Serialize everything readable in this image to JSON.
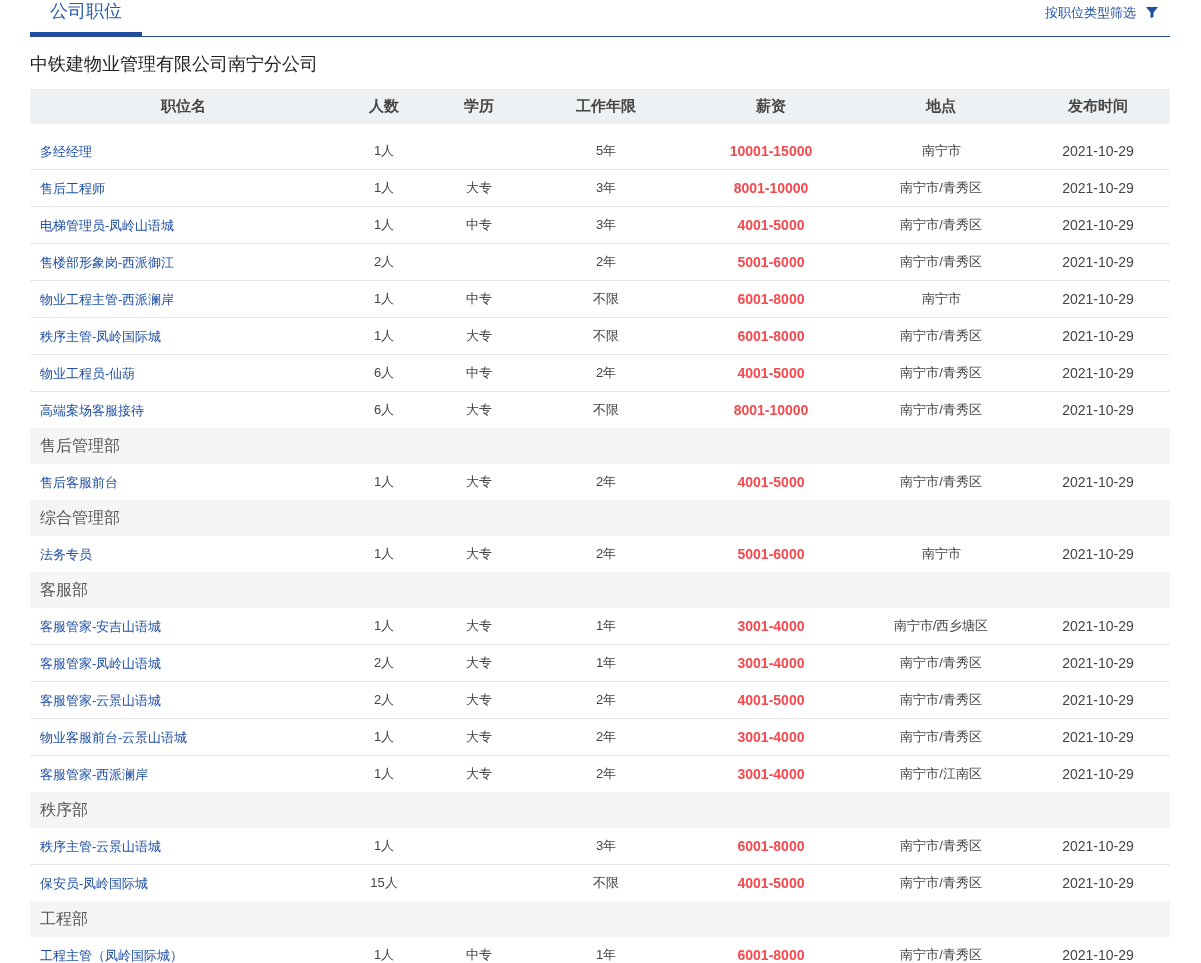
{
  "tabs": [
    {
      "label": "公司职位",
      "selected": true
    }
  ],
  "filter": {
    "label": "按职位类型筛选"
  },
  "company": "中铁建物业管理有限公司南宁分公司",
  "columns": [
    "职位名",
    "人数",
    "学历",
    "工作年限",
    "薪资",
    "地点",
    "发布时间"
  ],
  "groups": [
    {
      "jobs": [
        {
          "name": "多经经理",
          "count": "1人",
          "years": "5年",
          "salary": "10001-15000",
          "location": "南宁市",
          "date": "2021-10-29"
        },
        {
          "name": "售后工程师",
          "count": "1人",
          "education": "大专",
          "years": "3年",
          "salary": "8001-10000",
          "location": "南宁市/青秀区",
          "date": "2021-10-29"
        },
        {
          "name": "电梯管理员-凤岭山语城",
          "count": "1人",
          "education": "中专",
          "years": "3年",
          "salary": "4001-5000",
          "location": "南宁市/青秀区",
          "date": "2021-10-29"
        },
        {
          "name": "售楼部形象岗-西派御江",
          "count": "2人",
          "years": "2年",
          "salary": "5001-6000",
          "location": "南宁市/青秀区",
          "date": "2021-10-29"
        },
        {
          "name": "物业工程主管-西派澜岸",
          "count": "1人",
          "education": "中专",
          "years": "不限",
          "salary": "6001-8000",
          "location": "南宁市",
          "date": "2021-10-29"
        },
        {
          "name": "秩序主管-凤岭国际城",
          "count": "1人",
          "education": "大专",
          "years": "不限",
          "salary": "6001-8000",
          "location": "南宁市/青秀区",
          "date": "2021-10-29"
        },
        {
          "name": "物业工程员-仙葫",
          "count": "6人",
          "education": "中专",
          "years": "2年",
          "salary": "4001-5000",
          "location": "南宁市/青秀区",
          "date": "2021-10-29"
        },
        {
          "name": "高端案场客服接待",
          "count": "6人",
          "education": "大专",
          "years": "不限",
          "salary": "8001-10000",
          "location": "南宁市/青秀区",
          "date": "2021-10-29"
        }
      ]
    },
    {
      "title": "售后管理部",
      "jobs": [
        {
          "name": "售后客服前台",
          "count": "1人",
          "education": "大专",
          "years": "2年",
          "salary": "4001-5000",
          "location": "南宁市/青秀区",
          "date": "2021-10-29"
        }
      ]
    },
    {
      "title": "综合管理部",
      "jobs": [
        {
          "name": "法务专员",
          "count": "1人",
          "education": "大专",
          "years": "2年",
          "salary": "5001-6000",
          "location": "南宁市",
          "date": "2021-10-29"
        }
      ]
    },
    {
      "title": "客服部",
      "jobs": [
        {
          "name": "客服管家-安吉山语城",
          "count": "1人",
          "education": "大专",
          "years": "1年",
          "salary": "3001-4000",
          "location": "南宁市/西乡塘区",
          "date": "2021-10-29"
        },
        {
          "name": "客服管家-凤岭山语城",
          "count": "2人",
          "education": "大专",
          "years": "1年",
          "salary": "3001-4000",
          "location": "南宁市/青秀区",
          "date": "2021-10-29"
        },
        {
          "name": "客服管家-云景山语城",
          "count": "2人",
          "education": "大专",
          "years": "2年",
          "salary": "4001-5000",
          "location": "南宁市/青秀区",
          "date": "2021-10-29"
        },
        {
          "name": "物业客服前台-云景山语城",
          "count": "1人",
          "education": "大专",
          "years": "2年",
          "salary": "3001-4000",
          "location": "南宁市/青秀区",
          "date": "2021-10-29"
        },
        {
          "name": "客服管家-西派澜岸",
          "count": "1人",
          "education": "大专",
          "years": "2年",
          "salary": "3001-4000",
          "location": "南宁市/江南区",
          "date": "2021-10-29"
        }
      ]
    },
    {
      "title": "秩序部",
      "jobs": [
        {
          "name": "秩序主管-云景山语城",
          "count": "1人",
          "years": "3年",
          "salary": "6001-8000",
          "location": "南宁市/青秀区",
          "date": "2021-10-29"
        },
        {
          "name": "保安员-凤岭国际城",
          "count": "15人",
          "years": "不限",
          "salary": "4001-5000",
          "location": "南宁市/青秀区",
          "date": "2021-10-29"
        }
      ]
    },
    {
      "title": "工程部",
      "jobs": [
        {
          "name": "工程主管（凤岭国际城）",
          "count": "1人",
          "education": "中专",
          "years": "1年",
          "salary": "6001-8000",
          "location": "南宁市/青秀区",
          "date": "2021-10-29"
        }
      ]
    }
  ]
}
